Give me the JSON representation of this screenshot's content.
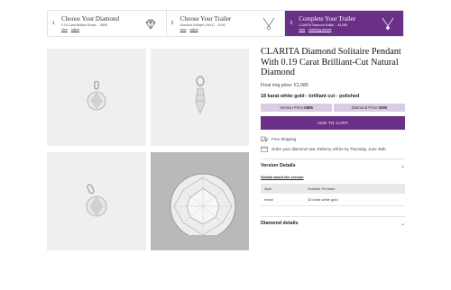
{
  "steps": [
    {
      "num": "1",
      "title": "Choose Your Diamond",
      "subtitle": "0.19 Carat Brilliant Shape ... €895",
      "links": [
        "view",
        "adjust"
      ],
      "icon": "diamond-icon"
    },
    {
      "num": "2",
      "title": "Choose Your Trailer",
      "subtitle": "Diamond Solitaire (Yea E ... €190",
      "links": [
        "view",
        "adjust"
      ],
      "icon": "pendant-outline-icon"
    },
    {
      "num": "3",
      "title": "Complete Your Trailer",
      "subtitle": "CLARITA Diamond Solitai ... €1,085",
      "links": [
        "view",
        "matching access"
      ],
      "icon": "pendant-icon"
    }
  ],
  "product": {
    "title": "CLARITA Diamond Solitaire Pendant With 0.19 Carat Brilliant-Cut Natural Diamond",
    "final_price": "Final ring price: €1,085",
    "spec": "18 karat white gold - brilliant cut - polished",
    "version_label": "Version Price:",
    "version_price": "€895",
    "diamond_label": "Diamond Price:",
    "diamond_price": "190€",
    "cart_label": "ADD TO CART"
  },
  "shipping": {
    "free": "Free Shipping",
    "delivery": "Order your diamond now. Delivery will be by Thursday, June 25th."
  },
  "version_details": {
    "heading": "Version Details",
    "link": "Details about the version",
    "columns": [
      "style",
      "Solitaire Pendant"
    ],
    "rows": [
      [
        "metal",
        "18 karat white gold"
      ]
    ]
  },
  "diamond_details": {
    "heading": "Diamond details"
  },
  "colors": {
    "accent": "#6a2f86",
    "price_bg": "#d8cde2"
  }
}
